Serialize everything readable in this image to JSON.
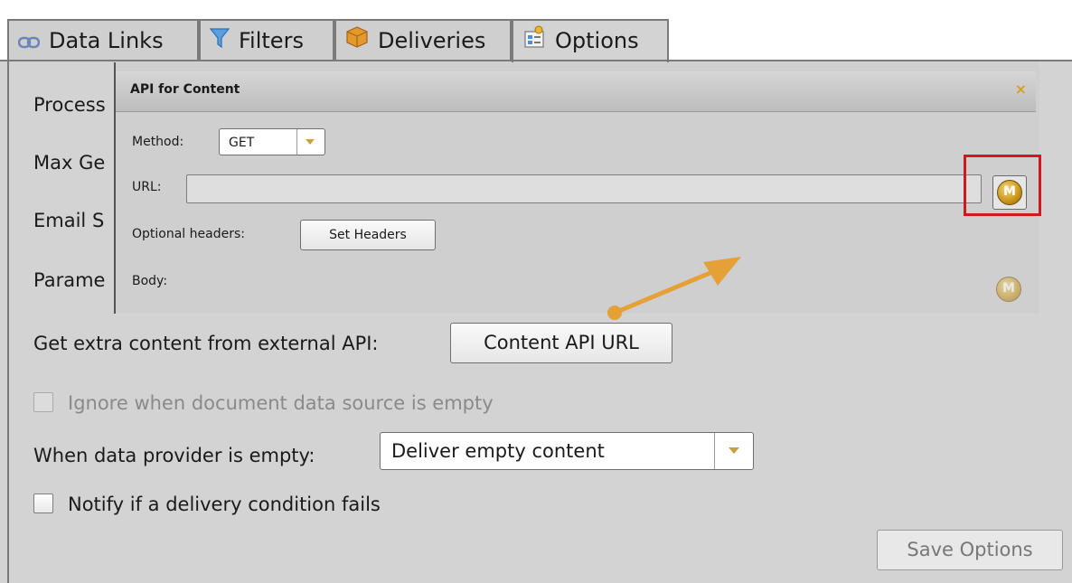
{
  "tabs": [
    {
      "label": "Data Links",
      "icon": "link-icon"
    },
    {
      "label": "Filters",
      "icon": "funnel-icon"
    },
    {
      "label": "Deliveries",
      "icon": "package-icon"
    },
    {
      "label": "Options",
      "icon": "options-icon"
    }
  ],
  "options": {
    "process_label": "Process",
    "max_label": "Max Ge",
    "email_label": "Email S",
    "param_label": "Parame",
    "extra_content_label": "Get extra content from external API:",
    "content_api_button": "Content API URL",
    "ignore_empty_label": "Ignore when document data source is empty",
    "empty_provider_label": "When data provider is empty:",
    "empty_provider_value": "Deliver empty content",
    "notify_label": "Notify if a delivery condition fails",
    "save_button": "Save Options"
  },
  "dialog": {
    "title": "API for Content",
    "close": "×",
    "method_label": "Method:",
    "method_value": "GET",
    "url_label": "URL:",
    "url_value": "",
    "headers_label": "Optional headers:",
    "headers_button": "Set Headers",
    "body_label": "Body:",
    "macro_icon_letter": "M"
  },
  "colors": {
    "highlight_box": "#d0191f",
    "arrow": "#e5a137",
    "accent": "#c7a043"
  }
}
